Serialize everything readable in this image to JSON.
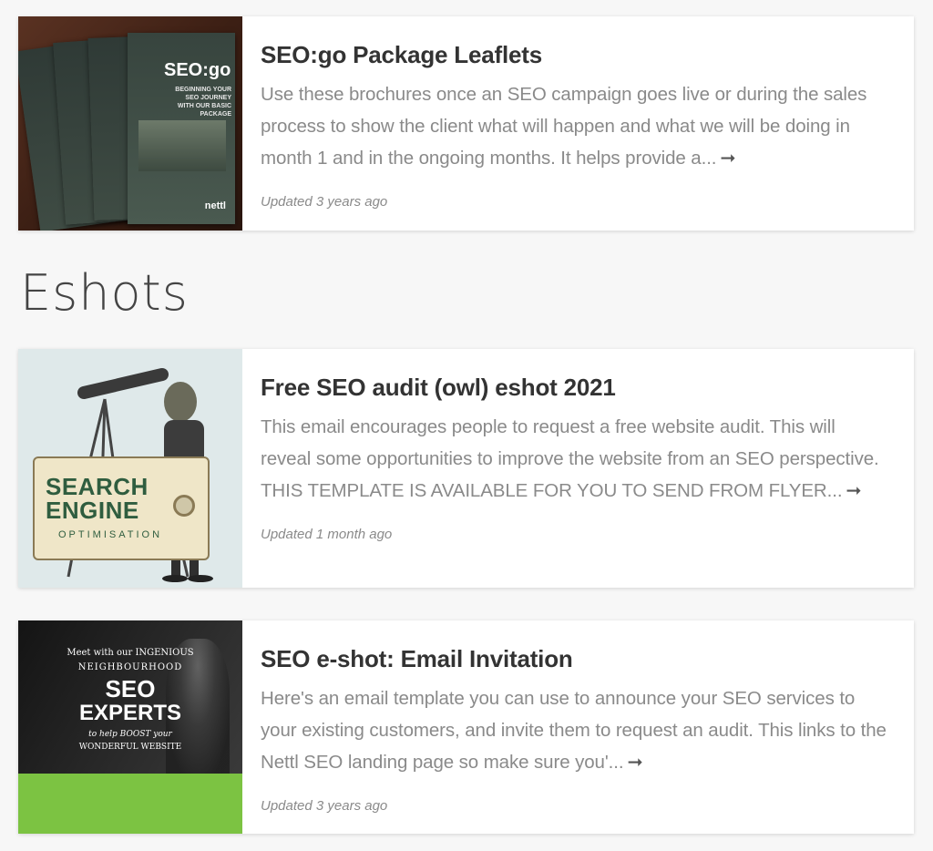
{
  "cards": [
    {
      "title": "SEO:go Package Leaflets",
      "description": "Use these brochures once an SEO campaign goes live or during the sales process to show the client what will happen and what we will be doing in month 1 and in the ongoing months. It helps provide a...",
      "arrow": "➞",
      "updated": "Updated 3 years ago",
      "thumb_text": {
        "brand": "SEO:go",
        "tagline": "BEGINNING YOUR SEO JOURNEY WITH OUR BASIC PACKAGE",
        "logo": "nettl"
      }
    },
    {
      "title": "Free SEO audit (owl) eshot 2021",
      "description": "This email encourages people to request a free website audit. This will reveal some opportunities to improve the website from an SEO perspective. THIS TEMPLATE IS AVAILABLE FOR YOU TO SEND FROM FLYER...",
      "arrow": "➞",
      "updated": "Updated 1 month ago",
      "thumb_text": {
        "line1": "SEARCH",
        "line2": "ENGINE",
        "line3": "OPTIMISATION"
      }
    },
    {
      "title": "SEO e-shot: Email Invitation",
      "description": "Here's an email template you can use to announce your SEO services to your existing customers, and invite them to request an audit. This links to the Nettl SEO landing page so make sure you'...",
      "arrow": "➞",
      "updated": "Updated 3 years ago",
      "thumb_text": {
        "line1": "Meet with our INGENIOUS",
        "line2": "NEIGHBOURHOOD",
        "line3": "SEO",
        "line4": "EXPERTS",
        "line5": "to help BOOST your",
        "line6": "WONDERFUL WEBSITE"
      }
    }
  ],
  "section": {
    "heading": "Eshots"
  },
  "colors": {
    "background": "#f7f7f7",
    "card": "#ffffff",
    "title": "#333333",
    "muted": "#8a8a8a",
    "sign_green": "#2f5d3f",
    "lime": "#7cc342"
  }
}
